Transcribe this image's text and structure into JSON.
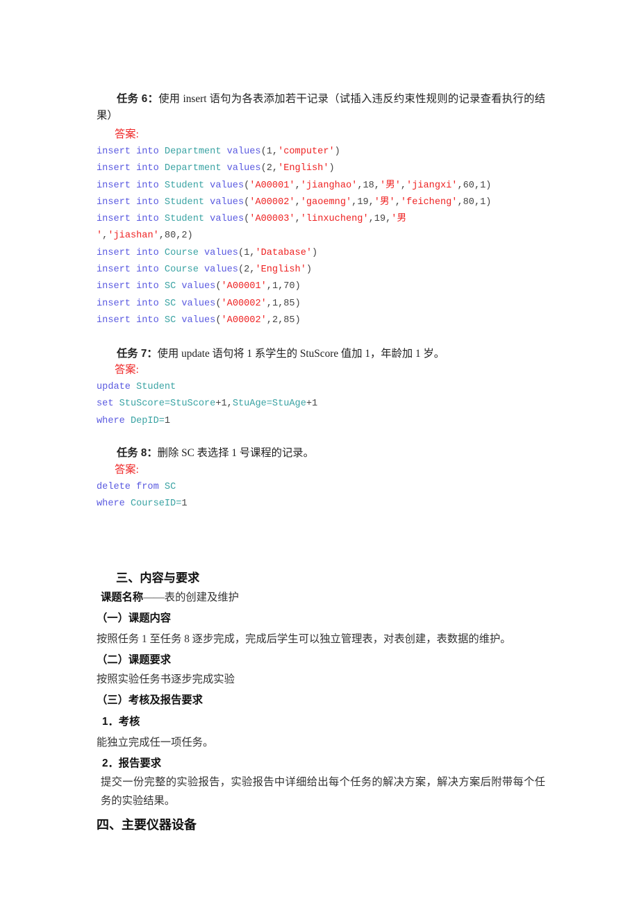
{
  "document": {
    "tasks": [
      {
        "id": "task-6",
        "label": "任务 6：",
        "text": "使用 insert 语句为各表添加若干记录（试插入违反约束性规则的记录查看执行的结果）",
        "answer_label": "答案:",
        "code_lines": [
          [
            {
              "t": "insert into ",
              "c": "kw"
            },
            {
              "t": "Department ",
              "c": "tbl"
            },
            {
              "t": "values",
              "c": "kw"
            },
            {
              "t": "(1,",
              "c": "pl"
            },
            {
              "t": "'computer'",
              "c": "str"
            },
            {
              "t": ")",
              "c": "pl"
            }
          ],
          [
            {
              "t": "insert into ",
              "c": "kw"
            },
            {
              "t": "Department ",
              "c": "tbl"
            },
            {
              "t": "values",
              "c": "kw"
            },
            {
              "t": "(2,",
              "c": "pl"
            },
            {
              "t": "'English'",
              "c": "str"
            },
            {
              "t": ")",
              "c": "pl"
            }
          ],
          [
            {
              "t": "insert into ",
              "c": "kw"
            },
            {
              "t": "Student ",
              "c": "tbl"
            },
            {
              "t": "values",
              "c": "kw"
            },
            {
              "t": "(",
              "c": "pl"
            },
            {
              "t": "'A00001'",
              "c": "str"
            },
            {
              "t": ",",
              "c": "pl"
            },
            {
              "t": "'jianghao'",
              "c": "str"
            },
            {
              "t": ",18,",
              "c": "pl"
            },
            {
              "t": "'男'",
              "c": "str"
            },
            {
              "t": ",",
              "c": "pl"
            },
            {
              "t": "'jiangxi'",
              "c": "str"
            },
            {
              "t": ",60,1)",
              "c": "pl"
            }
          ],
          [
            {
              "t": "insert into ",
              "c": "kw"
            },
            {
              "t": "Student ",
              "c": "tbl"
            },
            {
              "t": "values",
              "c": "kw"
            },
            {
              "t": "(",
              "c": "pl"
            },
            {
              "t": "'A00002'",
              "c": "str"
            },
            {
              "t": ",",
              "c": "pl"
            },
            {
              "t": "'gaoemng'",
              "c": "str"
            },
            {
              "t": ",19,",
              "c": "pl"
            },
            {
              "t": "'男'",
              "c": "str"
            },
            {
              "t": ",",
              "c": "pl"
            },
            {
              "t": "'feicheng'",
              "c": "str"
            },
            {
              "t": ",80,1)",
              "c": "pl"
            }
          ],
          [
            {
              "t": "insert into ",
              "c": "kw"
            },
            {
              "t": "Student ",
              "c": "tbl"
            },
            {
              "t": "values",
              "c": "kw"
            },
            {
              "t": "(",
              "c": "pl"
            },
            {
              "t": "'A00003'",
              "c": "str"
            },
            {
              "t": ",",
              "c": "pl"
            },
            {
              "t": "'linxucheng'",
              "c": "str"
            },
            {
              "t": ",19,",
              "c": "pl"
            },
            {
              "t": "'男",
              "c": "str"
            }
          ],
          [
            {
              "t": "'",
              "c": "str"
            },
            {
              "t": ",",
              "c": "pl"
            },
            {
              "t": "'jiashan'",
              "c": "str"
            },
            {
              "t": ",80,2)",
              "c": "pl"
            }
          ],
          [
            {
              "t": "insert into ",
              "c": "kw"
            },
            {
              "t": "Course ",
              "c": "tbl"
            },
            {
              "t": "values",
              "c": "kw"
            },
            {
              "t": "(1,",
              "c": "pl"
            },
            {
              "t": "'Database'",
              "c": "str"
            },
            {
              "t": ")",
              "c": "pl"
            }
          ],
          [
            {
              "t": "insert into ",
              "c": "kw"
            },
            {
              "t": "Course ",
              "c": "tbl"
            },
            {
              "t": "values",
              "c": "kw"
            },
            {
              "t": "(2,",
              "c": "pl"
            },
            {
              "t": "'English'",
              "c": "str"
            },
            {
              "t": ")",
              "c": "pl"
            }
          ],
          [
            {
              "t": "insert into ",
              "c": "kw"
            },
            {
              "t": "SC ",
              "c": "tbl"
            },
            {
              "t": "values",
              "c": "kw"
            },
            {
              "t": "(",
              "c": "pl"
            },
            {
              "t": "'A00001'",
              "c": "str"
            },
            {
              "t": ",1,70)",
              "c": "pl"
            }
          ],
          [
            {
              "t": "insert into ",
              "c": "kw"
            },
            {
              "t": "SC ",
              "c": "tbl"
            },
            {
              "t": "values",
              "c": "kw"
            },
            {
              "t": "(",
              "c": "pl"
            },
            {
              "t": "'A00002'",
              "c": "str"
            },
            {
              "t": ",1,85)",
              "c": "pl"
            }
          ],
          [
            {
              "t": "insert into ",
              "c": "kw"
            },
            {
              "t": "SC ",
              "c": "tbl"
            },
            {
              "t": "values",
              "c": "kw"
            },
            {
              "t": "(",
              "c": "pl"
            },
            {
              "t": "'A00002'",
              "c": "str"
            },
            {
              "t": ",2,85)",
              "c": "pl"
            }
          ]
        ]
      },
      {
        "id": "task-7",
        "label": "任务 7：",
        "text": "使用 update 语句将 1 系学生的 StuScore 值加 1，年龄加 1 岁。",
        "answer_label": "答案:",
        "code_lines": [
          [
            {
              "t": "update ",
              "c": "kw"
            },
            {
              "t": "Student",
              "c": "tbl"
            }
          ],
          [
            {
              "t": "set ",
              "c": "kw"
            },
            {
              "t": "StuScore=StuScore",
              "c": "tbl"
            },
            {
              "t": "+1,",
              "c": "pl"
            },
            {
              "t": "StuAge=StuAge",
              "c": "tbl"
            },
            {
              "t": "+1",
              "c": "pl"
            }
          ],
          [
            {
              "t": "where ",
              "c": "kw"
            },
            {
              "t": "DepID=",
              "c": "tbl"
            },
            {
              "t": "1",
              "c": "pl"
            }
          ]
        ]
      },
      {
        "id": "task-8",
        "label": "任务 8：",
        "text": "删除 SC 表选择 1 号课程的记录。",
        "answer_label": "答案:",
        "code_lines": [
          [
            {
              "t": "delete from ",
              "c": "kw"
            },
            {
              "t": "SC",
              "c": "tbl"
            }
          ],
          [
            {
              "t": "where ",
              "c": "kw"
            },
            {
              "t": "CourseID=",
              "c": "tbl"
            },
            {
              "t": "1",
              "c": "pl"
            }
          ]
        ]
      }
    ],
    "section_three": {
      "heading": "三、内容与要求",
      "topic_label": "课题名称",
      "topic_value": "——表的创建及维护",
      "sub_one_heading": "（一）课题内容",
      "sub_one_text": "按照任务 1 至任务 8 逐步完成，完成后学生可以独立管理表，对表创建，表数据的维护。",
      "sub_two_heading": "（二）课题要求",
      "sub_two_text": "按照实验任务书逐步完成实验",
      "sub_three_heading": "（三）考核及报告要求",
      "item_one_heading": "1．考核",
      "item_one_text": "能独立完成任一项任务。",
      "item_two_heading": "2．报告要求",
      "item_two_text": "提交一份完整的实验报告，实验报告中详细给出每个任务的解决方案，解决方案后附带每个任务的实验结果。"
    },
    "section_four": {
      "heading": "四、主要仪器设备"
    }
  }
}
